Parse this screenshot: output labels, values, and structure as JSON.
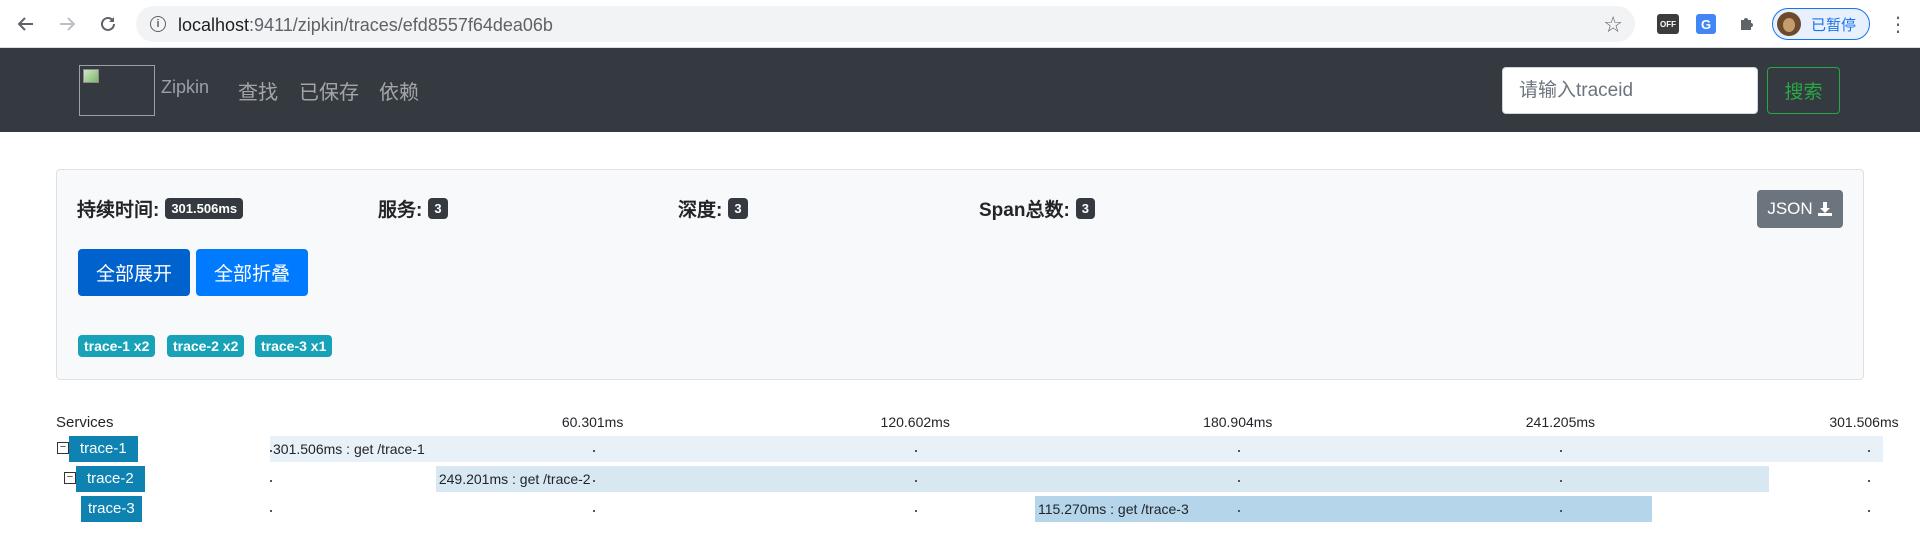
{
  "browser": {
    "url_host": "localhost",
    "url_rest": ":9411/zipkin/traces/efd8557f64dea06b",
    "profile_label": "已暂停",
    "icons": [
      "back-icon",
      "forward-icon",
      "reload-icon",
      "info-icon",
      "star-icon",
      "off-extension-icon",
      "translate-extension-icon",
      "puzzle-icon",
      "avatar",
      "menu-icon"
    ],
    "ext_off_label": "OFF",
    "ext_translate_label": "G"
  },
  "navbar": {
    "brand": "Zipkin",
    "links": [
      "查找",
      "已保存",
      "依赖"
    ],
    "search_placeholder": "请输入traceid",
    "search_button": "搜索"
  },
  "summary": {
    "duration_label": "持续时间:",
    "duration_value": "301.506ms",
    "services_label": "服务:",
    "services_value": "3",
    "depth_label": "深度:",
    "depth_value": "3",
    "span_total_label": "Span总数:",
    "span_total_value": "3",
    "json_button": "JSON",
    "expand_all": "全部展开",
    "collapse_all": "全部折叠",
    "service_badges": [
      "trace-1 x2",
      "trace-2 x2",
      "trace-3 x1"
    ],
    "colors": {
      "expand": "#0062cc",
      "collapse": "#007bff",
      "badge": "#17a2b8"
    }
  },
  "timeline": {
    "services_header": "Services",
    "total_ms": 301.506,
    "ticks": [
      "60.301ms",
      "120.602ms",
      "180.904ms",
      "241.205ms",
      "301.506ms"
    ],
    "tick_values_ms": [
      60.301,
      120.602,
      180.904,
      241.205,
      301.506
    ],
    "spans": [
      {
        "service": "trace-1",
        "label": "301.506ms : get /trace-1",
        "start_ms": 0,
        "duration_ms": 301.506,
        "depth": 0,
        "collapsible": true,
        "color": "#e8f1f7"
      },
      {
        "service": "trace-2",
        "label": "249.201ms : get /trace-2",
        "start_ms": 31.0,
        "duration_ms": 249.201,
        "depth": 1,
        "collapsible": true,
        "color": "#d8e8f3"
      },
      {
        "service": "trace-3",
        "label": "115.270ms : get /trace-3",
        "start_ms": 143.0,
        "duration_ms": 115.27,
        "depth": 2,
        "collapsible": false,
        "color": "#b4d5ea"
      }
    ],
    "service_color": "#0e83b1"
  }
}
